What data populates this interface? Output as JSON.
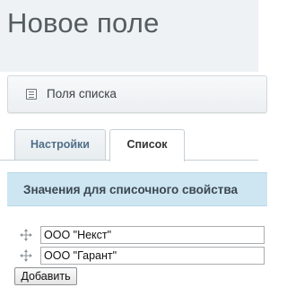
{
  "page": {
    "title": "Новое поле"
  },
  "fields_panel": {
    "label": "Поля списка",
    "icon": "list-icon"
  },
  "tabs": [
    {
      "label": "Настройки",
      "active": false
    },
    {
      "label": "Список",
      "active": true
    }
  ],
  "section": {
    "title": "Значения для списочного свойства"
  },
  "values": [
    {
      "value": "ООО \"Некст\"",
      "handle_icon": "drag-handle-icon"
    },
    {
      "value": "ООО \"Гарант\"",
      "handle_icon": "drag-handle-icon"
    }
  ],
  "actions": {
    "add_label": "Добавить"
  },
  "colors": {
    "header_bg": "#eef2f4",
    "section_bg": "#cde6f1",
    "tab_inactive_text": "#4f6f89",
    "title_text": "#555c61"
  }
}
